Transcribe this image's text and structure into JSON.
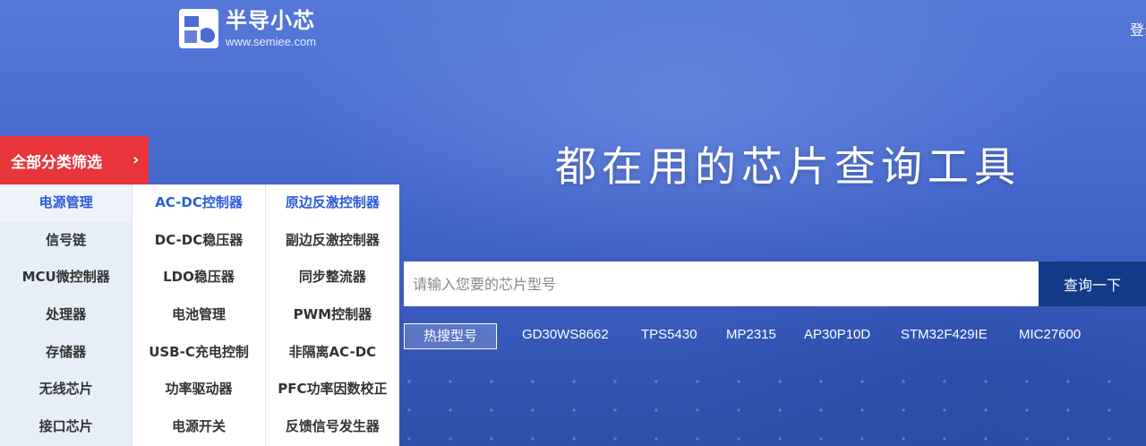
{
  "header": {
    "logo_name": "半导小芯",
    "logo_url": "www.semiee.com",
    "login_label": "登录"
  },
  "category": {
    "header_label": "全部分类筛选",
    "chevron": "›",
    "columns": [
      [
        "电源管理",
        "信号链",
        "MCU微控制器",
        "处理器",
        "存储器",
        "无线芯片",
        "接口芯片"
      ],
      [
        "AC-DC控制器",
        "DC-DC稳压器",
        "LDO稳压器",
        "电池管理",
        "USB-C充电控制",
        "功率驱动器",
        "电源开关"
      ],
      [
        "原边反激控制器",
        "副边反激控制器",
        "同步整流器",
        "PWM控制器",
        "非隔离AC-DC",
        "PFC功率因数校正",
        "反馈信号发生器"
      ]
    ]
  },
  "hero": {
    "title": "都在用的芯片查询工具"
  },
  "search": {
    "placeholder": "请输入您要的芯片型号",
    "button_label": "查询一下"
  },
  "hot": {
    "label": "热搜型号",
    "items": [
      "GD30WS8662",
      "TPS5430",
      "MP2315",
      "AP30P10D",
      "STM32F429IE",
      "MIC27600"
    ]
  },
  "colors": {
    "accent_red": "#e8353b",
    "active_blue": "#2a5bd7",
    "button_navy": "#123a86"
  }
}
